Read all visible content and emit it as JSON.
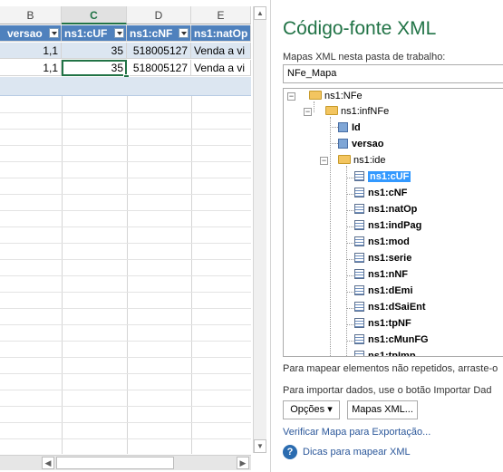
{
  "spreadsheet": {
    "columns": [
      {
        "letter": "B",
        "selected": false
      },
      {
        "letter": "C",
        "selected": true
      },
      {
        "letter": "D",
        "selected": false
      },
      {
        "letter": "E",
        "selected": false
      }
    ],
    "table_headers": [
      "versao",
      "ns1:cUF",
      "ns1:cNF",
      "ns1:natOp"
    ],
    "rows": [
      [
        "1,1",
        "35",
        "518005127",
        "Venda a vi"
      ],
      [
        "1,1",
        "35",
        "518005127",
        "Venda a vi"
      ]
    ]
  },
  "pane": {
    "title": "Código-fonte XML",
    "maps_label": "Mapas XML nesta pasta de trabalho:",
    "selected_map": "NFe_Mapa",
    "tree": [
      {
        "label": "ns1:NFe",
        "icon": "folder",
        "toggle": "−",
        "bold": false
      },
      {
        "label": "ns1:infNFe",
        "icon": "folder",
        "toggle": "−",
        "bold": false
      },
      {
        "label": "Id",
        "icon": "element",
        "bold": true
      },
      {
        "label": "versao",
        "icon": "element",
        "bold": true
      },
      {
        "label": "ns1:ide",
        "icon": "folder",
        "toggle": "−",
        "bold": false
      },
      {
        "label": "ns1:cUF",
        "icon": "repeating-element",
        "bold": true,
        "selected": true
      },
      {
        "label": "ns1:cNF",
        "icon": "repeating-element",
        "bold": true
      },
      {
        "label": "ns1:natOp",
        "icon": "repeating-element",
        "bold": true
      },
      {
        "label": "ns1:indPag",
        "icon": "repeating-element",
        "bold": true
      },
      {
        "label": "ns1:mod",
        "icon": "repeating-element",
        "bold": true
      },
      {
        "label": "ns1:serie",
        "icon": "repeating-element",
        "bold": true
      },
      {
        "label": "ns1:nNF",
        "icon": "repeating-element",
        "bold": true
      },
      {
        "label": "ns1:dEmi",
        "icon": "repeating-element",
        "bold": true
      },
      {
        "label": "ns1:dSaiEnt",
        "icon": "repeating-element",
        "bold": true
      },
      {
        "label": "ns1:tpNF",
        "icon": "repeating-element",
        "bold": true
      },
      {
        "label": "ns1:cMunFG",
        "icon": "repeating-element",
        "bold": true
      },
      {
        "label": "ns1:tpImp",
        "icon": "repeating-element",
        "bold": true
      }
    ],
    "hint_nonrepeating": "Para mapear elementos não repetidos, arraste-o",
    "hint_import": "Para importar dados, use o botão Importar Dad",
    "options_button": "Opções ▾",
    "xml_maps_button": "Mapas XML...",
    "verify_link": "Verificar Mapa para Exportação...",
    "tips_link": "Dicas para mapear XML",
    "help_icon_glyph": "?"
  },
  "colors": {
    "accent": "#217346",
    "table_header": "#4f81bd",
    "table_band": "#dce6f1",
    "selection": "#3399ff",
    "link": "#2b579a"
  }
}
